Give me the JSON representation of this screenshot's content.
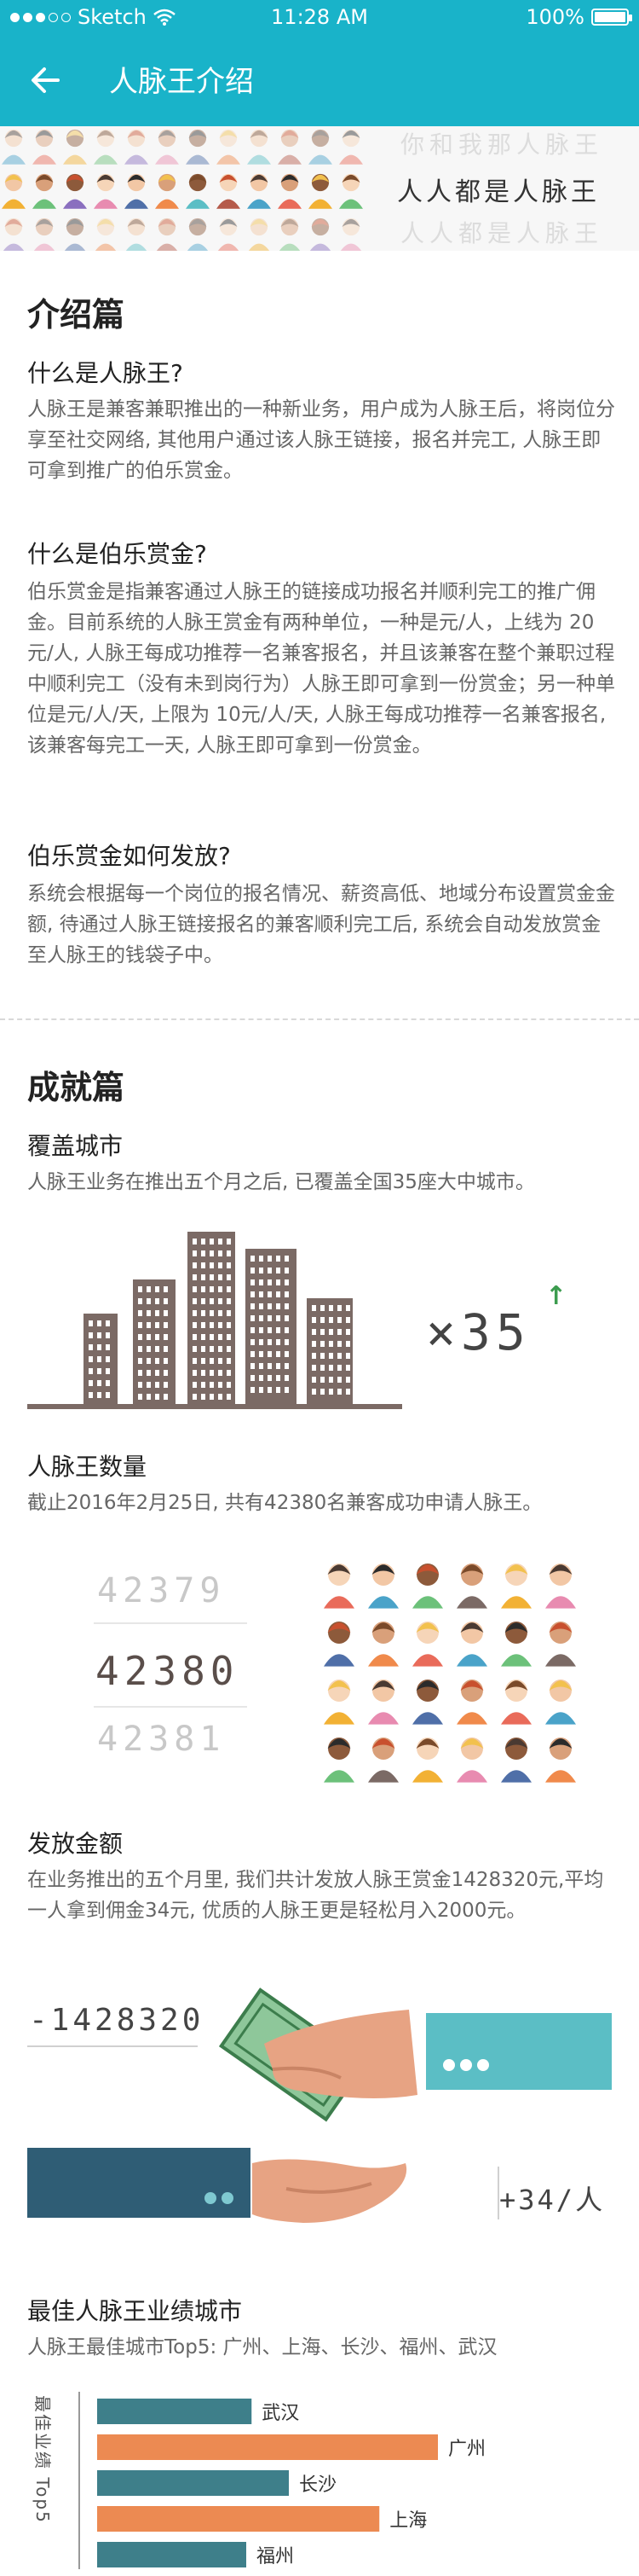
{
  "status_bar": {
    "carrier": "Sketch",
    "time": "11:28 AM",
    "battery": "100%"
  },
  "nav": {
    "title": "人脉王介绍"
  },
  "banner": {
    "slogan": "人人都是人脉王",
    "ghost_top": "你和我那人脉王",
    "ghost_bottom": "人人都是人脉王"
  },
  "intro": {
    "title": "介绍篇",
    "q1": {
      "title": "什么是人脉王?",
      "text": "人脉王是兼客兼职推出的一种新业务，用户成为人脉王后，将岗位分享至社交网络, 其他用户通过该人脉王链接，报名并完工, 人脉王即可拿到推广的伯乐赏金。"
    },
    "q2": {
      "title": "什么是伯乐赏金?",
      "text": "伯乐赏金是指兼客通过人脉王的链接成功报名并顺利完工的推广佣金。目前系统的人脉王赏金有两种单位，一种是元/人，上线为 20元/人, 人脉王每成功推荐一名兼客报名，并且该兼客在整个兼职过程中顺利完工（没有未到岗行为）人脉王即可拿到一份赏金；另一种单位是元/人/天, 上限为 10元/人/天, 人脉王每成功推荐一名兼客报名, 该兼客每完工一天, 人脉王即可拿到一份赏金。"
    },
    "q3": {
      "title": "伯乐赏金如何发放?",
      "text": "系统会根据每一个岗位的报名情况、薪资高低、地域分布设置赏金金额, 待通过人脉王链接报名的兼客顺利完工后, 系统会自动发放赏金至人脉王的钱袋子中。"
    }
  },
  "achieve": {
    "title": "成就篇",
    "cities": {
      "title": "覆盖城市",
      "text": "人脉王业务在推出五个月之后, 已覆盖全国35座大中城市。",
      "multiplier": "×35",
      "arrow": "↑"
    },
    "count": {
      "title": "人脉王数量",
      "text": "截止2016年2月25日, 共有42380名兼客成功申请人脉王。",
      "numbers": [
        "42379",
        "42380",
        "42381"
      ]
    },
    "money": {
      "title": "发放金额",
      "text": "在业务推出的五个月里, 我们共计发放人脉王赏金1428320元,平均一人拿到佣金34元, 优质的人脉王更是轻松月入2000元。",
      "total": "-1428320",
      "avg": "+34/人"
    },
    "top": {
      "title": "最佳人脉王业绩城市",
      "text": "人脉王最佳城市Top5:  广州、上海、长沙、福州、武汉",
      "axis_label": "最佳业绩 Top5"
    }
  },
  "chart_data": {
    "type": "bar",
    "orientation": "horizontal",
    "categories": [
      "武汉",
      "广州",
      "长沙",
      "上海",
      "福州"
    ],
    "values": [
      145,
      320,
      180,
      265,
      140
    ],
    "colors": [
      "#3e7f8a",
      "#ec8a52",
      "#3e7f8a",
      "#ec8a52",
      "#3e7f8a"
    ],
    "ylabel": "最佳业绩 Top5",
    "grid": false
  },
  "colors": {
    "accent": "#19b3c9",
    "building": "#7b6a65",
    "orange": "#ec8a52",
    "teal": "#5bbec5",
    "navy": "#2f5d75",
    "green": "#3c9c4f"
  }
}
